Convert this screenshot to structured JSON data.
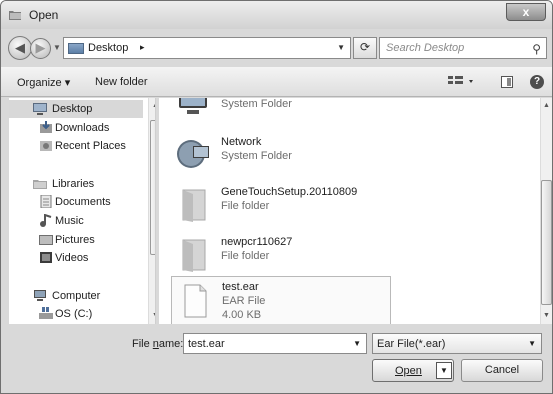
{
  "window": {
    "title": "Open",
    "close_label": "x"
  },
  "address": {
    "location": "Desktop",
    "separator": "▸",
    "search_placeholder": "Search Desktop"
  },
  "command_bar": {
    "organize_label": "Organize ▾",
    "new_folder_label": "New folder"
  },
  "sidebar": {
    "items": [
      {
        "label": "Desktop",
        "icon": "desktop-icon",
        "selected": true
      },
      {
        "label": "Downloads",
        "icon": "downloads-icon"
      },
      {
        "label": "Recent Places",
        "icon": "recent-places-icon"
      },
      {
        "label": "Libraries",
        "icon": "libraries-icon"
      },
      {
        "label": "Documents",
        "icon": "documents-icon"
      },
      {
        "label": "Music",
        "icon": "music-icon"
      },
      {
        "label": "Pictures",
        "icon": "pictures-icon"
      },
      {
        "label": "Videos",
        "icon": "videos-icon"
      },
      {
        "label": "Computer",
        "icon": "computer-icon"
      },
      {
        "label": "OS (C:)",
        "icon": "drive-icon"
      }
    ]
  },
  "files": [
    {
      "name": "",
      "type": "System Folder",
      "icon": "computer-icon"
    },
    {
      "name": "Network",
      "type": "System Folder",
      "icon": "network-icon"
    },
    {
      "name": "GeneTouchSetup.20110809",
      "type": "File folder",
      "icon": "folder-icon"
    },
    {
      "name": "newpcr110627",
      "type": "File folder",
      "icon": "folder-icon"
    },
    {
      "name": "test.ear",
      "type": "EAR File",
      "size": "4.00 KB",
      "icon": "file-icon",
      "selected": true
    }
  ],
  "bottom": {
    "file_name_label_pre": "File ",
    "file_name_label_u": "n",
    "file_name_label_post": "ame:",
    "file_name_value": "test.ear",
    "filter_value": "Ear File(*.ear)",
    "open_label": "Open",
    "cancel_label": "Cancel"
  },
  "colors": {
    "chrome": "#d9d9d9",
    "selection": "#d8d8d8",
    "secondary_text": "#6d6d6d"
  }
}
